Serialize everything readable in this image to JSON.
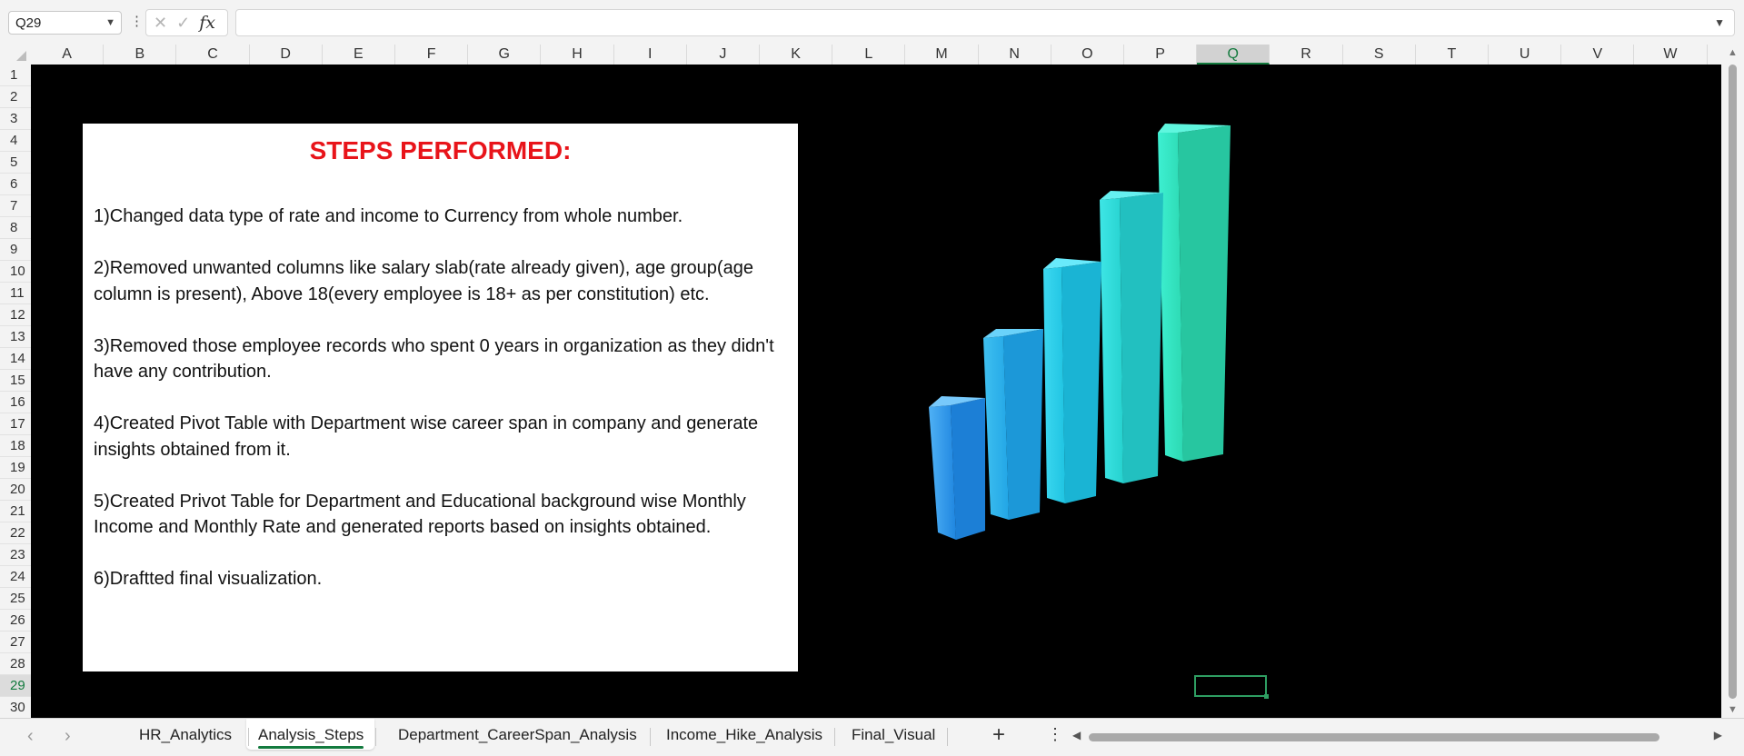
{
  "formula_bar": {
    "name_box": "Q29",
    "formula": "",
    "icons": [
      "cancel-icon",
      "confirm-icon",
      "fx-icon"
    ]
  },
  "columns": [
    "A",
    "B",
    "C",
    "D",
    "E",
    "F",
    "G",
    "H",
    "I",
    "J",
    "K",
    "L",
    "M",
    "N",
    "O",
    "P",
    "Q",
    "R",
    "S",
    "T",
    "U",
    "V",
    "W"
  ],
  "selected_column": "Q",
  "rows": [
    "1",
    "2",
    "3",
    "4",
    "5",
    "6",
    "7",
    "8",
    "9",
    "10",
    "11",
    "12",
    "13",
    "14",
    "15",
    "16",
    "17",
    "18",
    "19",
    "20",
    "21",
    "22",
    "23",
    "24",
    "25",
    "26",
    "27",
    "28",
    "29",
    "30"
  ],
  "selected_row": "29",
  "textbox": {
    "title": "STEPS PERFORMED:",
    "steps": [
      "1)Changed data type of rate and income to Currency from whole number.",
      "2)Removed unwanted columns like salary slab(rate already given), age group(age column is present), Above 18(every employee is 18+ as per constitution) etc.",
      "3)Removed those employee records who spent 0 years in organization as they didn't have any contribution.",
      "4)Created Pivot Table with Department wise career span in company and generate insights obtained from it.",
      "5)Created Privot Table for Department and Educational background wise Monthly Income and Monthly Rate and generated reports based on insights obtained.",
      "6)Draftted final visualization."
    ]
  },
  "sheet_tabs": {
    "tabs": [
      "HR_Analytics",
      "Analysis_Steps",
      "Department_CareerSpan_Analysis",
      "Income_Hike_Analysis",
      "Final_Visual"
    ],
    "active": "Analysis_Steps"
  },
  "colors": {
    "sheet_background": "#000000",
    "title_color": "#e8141a",
    "accent_green": "#137a3e",
    "bar_gradient_start": "#1e88e5",
    "bar_gradient_end": "#2ed8a8"
  }
}
